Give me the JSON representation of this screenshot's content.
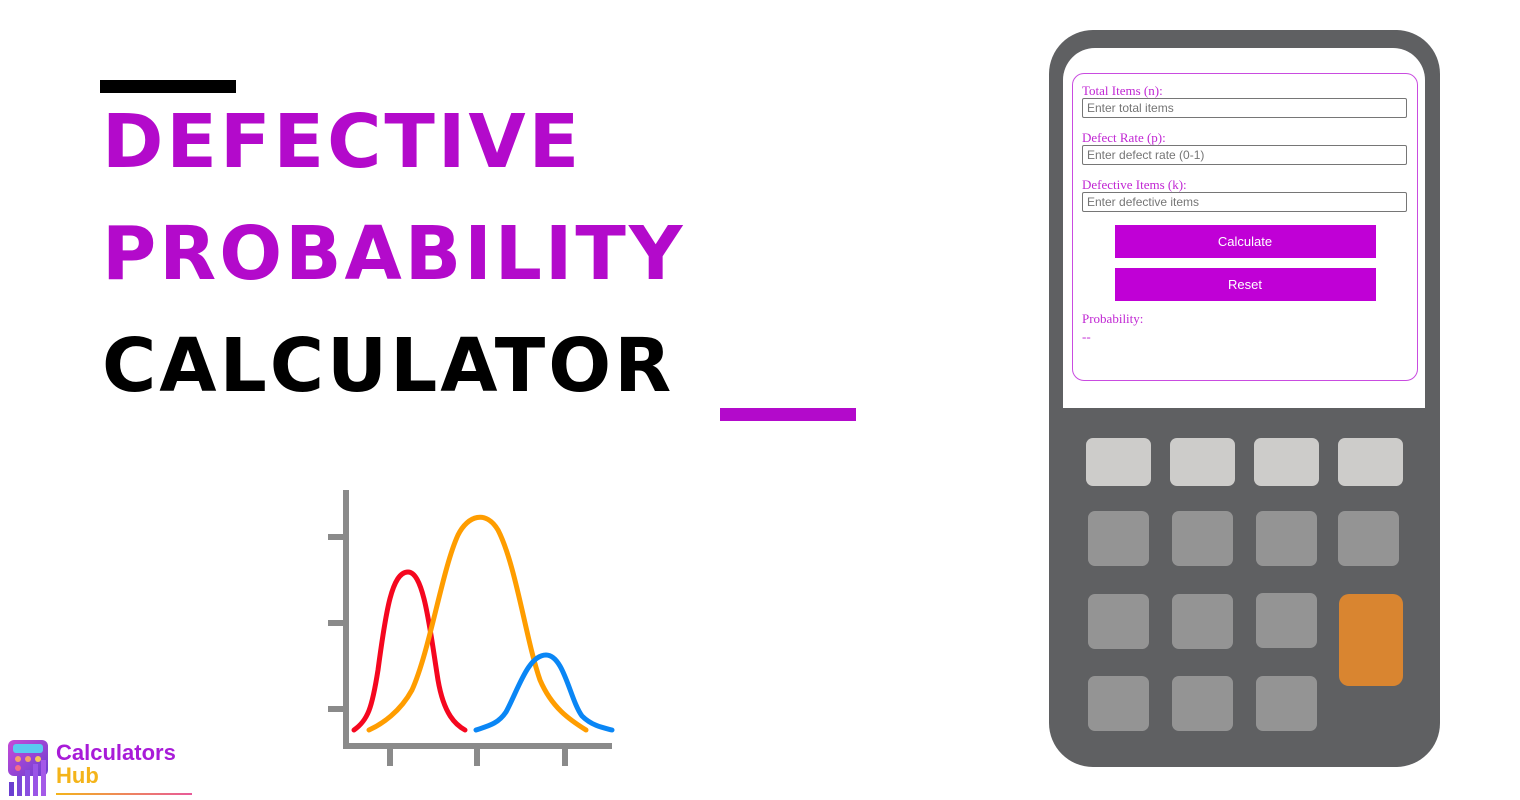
{
  "title": {
    "line1": "Defective",
    "line2": "Probability",
    "line3": "Calculator"
  },
  "colors": {
    "accent": "#b30acb",
    "button": "#c000d6",
    "label": "#c026d3",
    "calculator_body": "#5f6062",
    "key_light": "#cdccca",
    "key_mid": "#949494",
    "key_orange": "#d98530"
  },
  "calculator": {
    "fields": [
      {
        "label": "Total Items (n):",
        "placeholder": "Enter total items",
        "value": ""
      },
      {
        "label": "Defect Rate (p):",
        "placeholder": "Enter defect rate (0-1)",
        "value": ""
      },
      {
        "label": "Defective Items (k):",
        "placeholder": "Enter defective items",
        "value": ""
      }
    ],
    "buttons": {
      "calculate": "Calculate",
      "reset": "Reset"
    },
    "result": {
      "label": "Probability:",
      "value": "--"
    }
  },
  "illustration": {
    "curves": [
      {
        "name": "red-curve",
        "color": "#f5071f"
      },
      {
        "name": "orange-curve",
        "color": "#ff9d00"
      },
      {
        "name": "blue-curve",
        "color": "#0a86f5"
      }
    ],
    "axis_color": "#8a8a8a"
  },
  "logo": {
    "line1": "Calculators",
    "line2": "Hub"
  }
}
